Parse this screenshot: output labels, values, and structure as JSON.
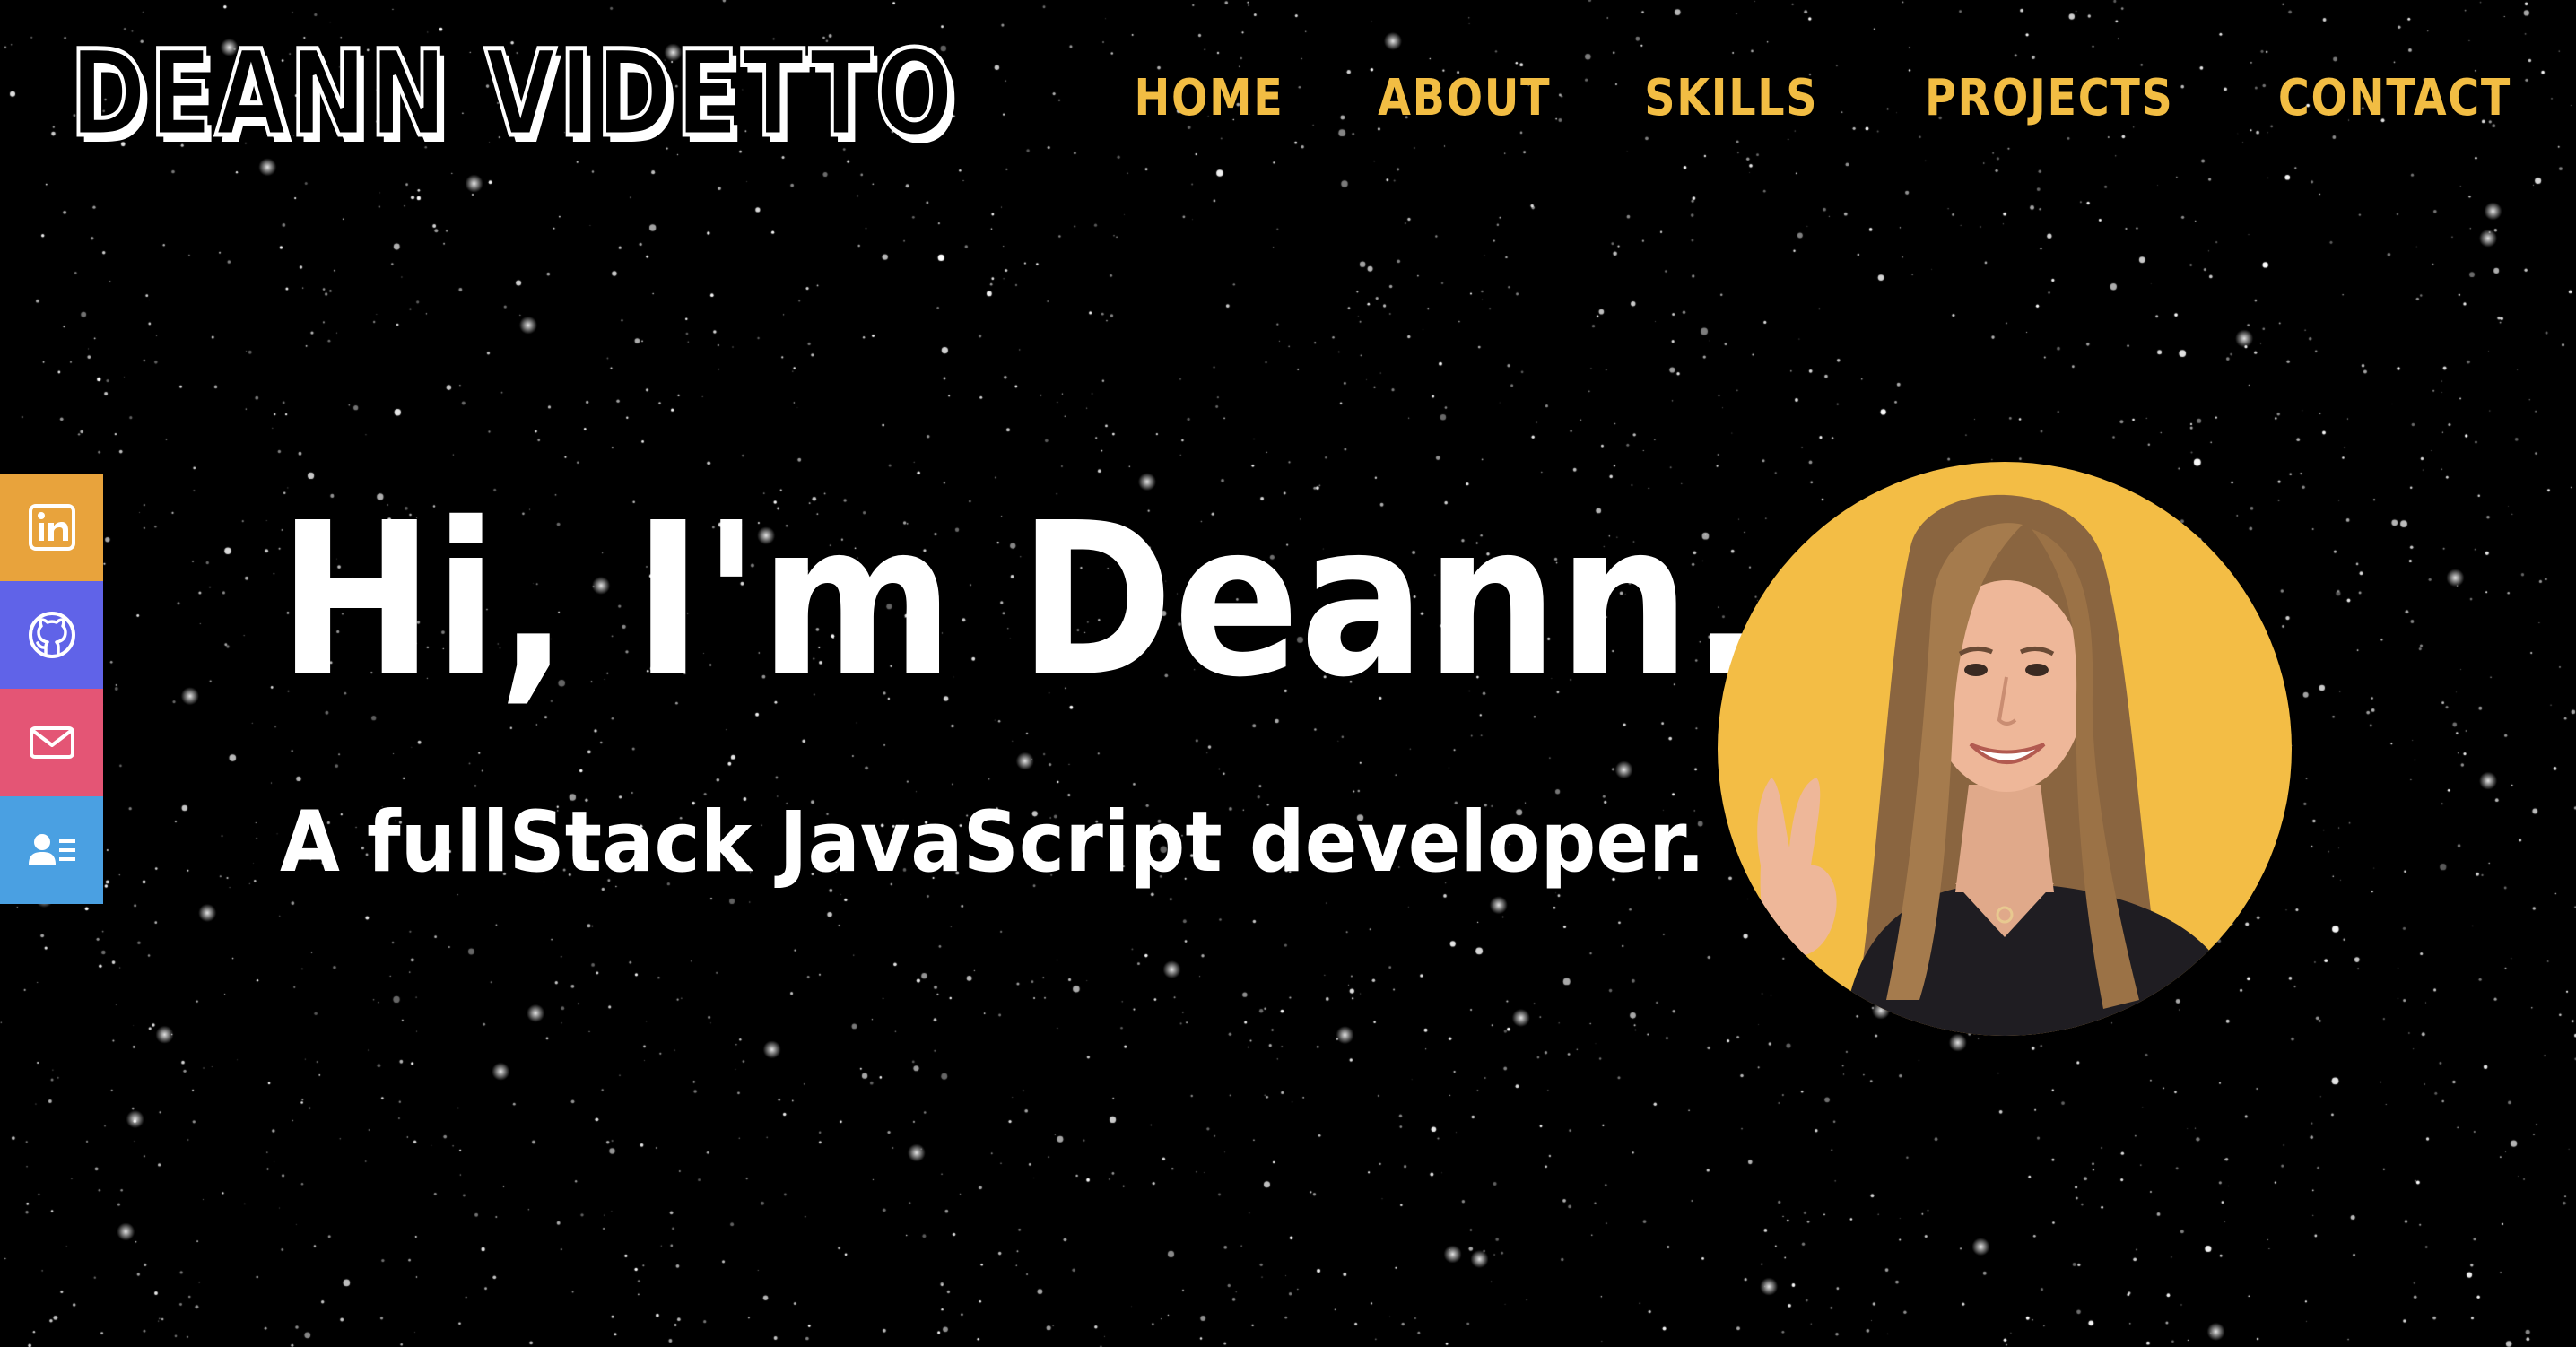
{
  "header": {
    "logo": "DEANN VIDETTO",
    "nav": [
      "HOME",
      "ABOUT",
      "SKILLS",
      "PROJECTS",
      "CONTACT"
    ]
  },
  "hero": {
    "title": "Hi, I'm Deann.",
    "subtitle": "A fullStack JavaScript developer."
  },
  "social": [
    {
      "icon": "linkedin-icon",
      "color": "#e8a33c"
    },
    {
      "icon": "github-icon",
      "color": "#6063e8"
    },
    {
      "icon": "mail-icon",
      "color": "#e45575"
    },
    {
      "icon": "resume-icon",
      "color": "#4aa0e2"
    }
  ],
  "colors": {
    "background": "#000000",
    "accent": "#f2bd43",
    "text": "#ffffff",
    "avatar_bg": "#f3bd45"
  }
}
